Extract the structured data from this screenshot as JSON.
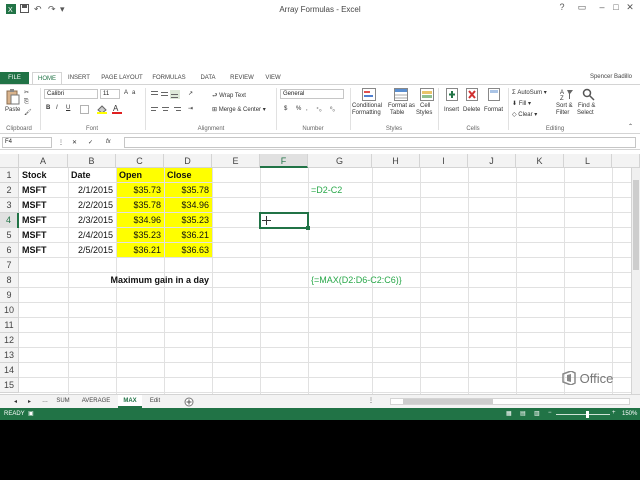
{
  "window": {
    "title": "Array Formulas - Excel",
    "user": "Spencer Badillo"
  },
  "tabs": [
    "FILE",
    "HOME",
    "INSERT",
    "PAGE LAYOUT",
    "FORMULAS",
    "DATA",
    "REVIEW",
    "VIEW"
  ],
  "ribbon": {
    "paste": "Paste",
    "font_name": "Calibri",
    "font_size": "11",
    "bold": "B",
    "italic": "I",
    "underline": "U",
    "wrap_text": "Wrap Text",
    "merge_center": "Merge & Center",
    "number_format": "General",
    "currency": "$",
    "percent": "%",
    "comma": ",",
    "conditional": "Conditional",
    "conditional2": "Formatting",
    "format_as": "Format as",
    "format_as2": "Table",
    "cell_styles": "Cell",
    "cell_styles2": "Styles",
    "insert": "Insert",
    "delete": "Delete",
    "format": "Format",
    "autosum": "AutoSum",
    "fill": "Fill",
    "clear": "Clear",
    "sort_filter": "Sort &",
    "sort_filter2": "Filter",
    "find_select": "Find &",
    "find_select2": "Select",
    "groups": {
      "clipboard": "Clipboard",
      "font": "Font",
      "alignment": "Alignment",
      "number": "Number",
      "styles": "Styles",
      "cells": "Cells",
      "editing": "Editing"
    }
  },
  "formula_bar": {
    "name_box": "F4",
    "fx": "fx",
    "value": ""
  },
  "columns": [
    "A",
    "B",
    "C",
    "D",
    "E",
    "F",
    "G",
    "H",
    "I",
    "J",
    "K",
    "L"
  ],
  "rows": [
    "1",
    "2",
    "3",
    "4",
    "5",
    "6",
    "7",
    "8",
    "9",
    "10",
    "11",
    "12",
    "13",
    "14",
    "15"
  ],
  "headers": {
    "stock": "Stock",
    "date": "Date",
    "open": "Open",
    "close": "Close"
  },
  "data_rows": [
    {
      "stock": "MSFT",
      "date": "2/1/2015",
      "open": "$35.73",
      "close": "$35.78"
    },
    {
      "stock": "MSFT",
      "date": "2/2/2015",
      "open": "$35.78",
      "close": "$34.96"
    },
    {
      "stock": "MSFT",
      "date": "2/3/2015",
      "open": "$34.96",
      "close": "$35.23"
    },
    {
      "stock": "MSFT",
      "date": "2/4/2015",
      "open": "$35.23",
      "close": "$36.21"
    },
    {
      "stock": "MSFT",
      "date": "2/5/2015",
      "open": "$36.21",
      "close": "$36.63"
    }
  ],
  "notes": {
    "formula1": "=D2-C2",
    "max_label": "Maximum gain in a day",
    "formula2": "{=MAX(D2:D6-C2:C6)}"
  },
  "sheets": [
    "SUM",
    "AVERAGE",
    "MAX",
    "Edit"
  ],
  "active_sheet": "MAX",
  "status": {
    "ready": "READY",
    "zoom": "150%"
  },
  "logo": "Office",
  "colors": {
    "excel_green": "#217346",
    "yellow": "#ffff00",
    "formula_green": "#2aa84a"
  }
}
